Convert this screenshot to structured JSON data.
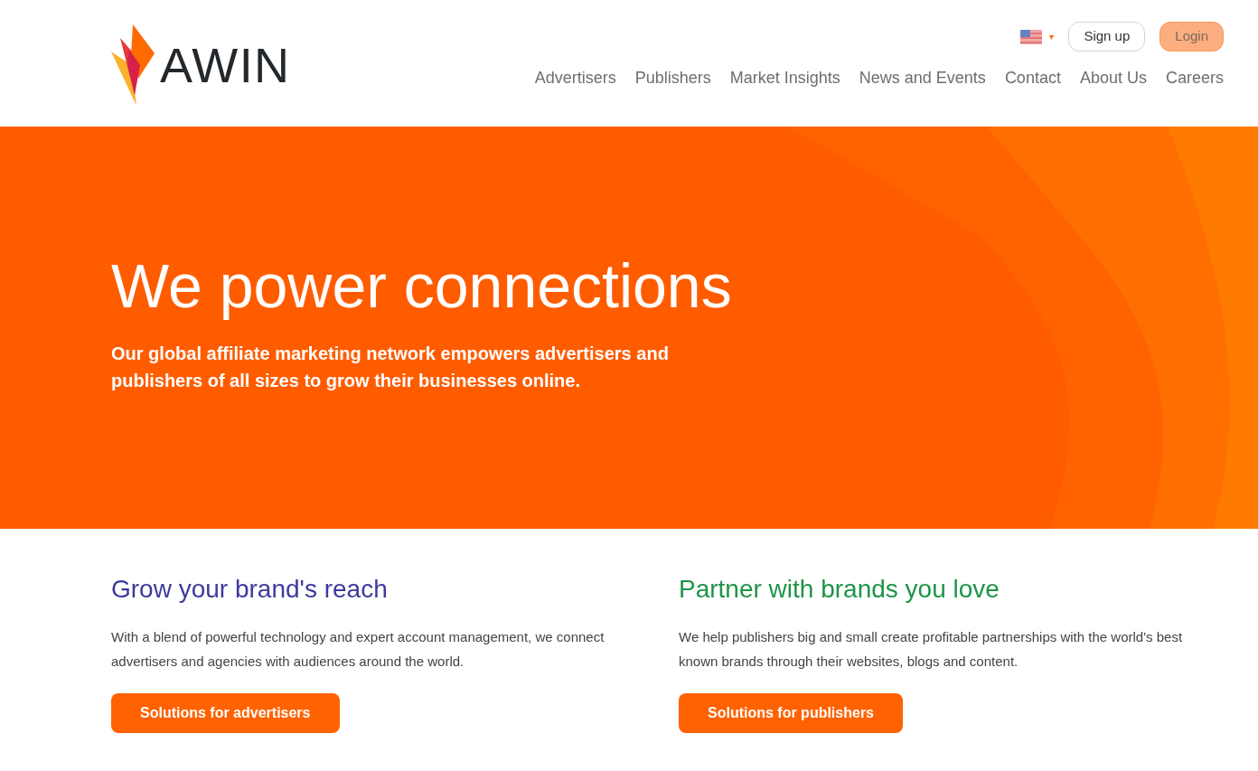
{
  "header": {
    "logo": "AWIN",
    "language_caret": "▾",
    "sign_up": "Sign up",
    "login": "Login",
    "nav": [
      {
        "label": "Advertisers"
      },
      {
        "label": "Publishers"
      },
      {
        "label": "Market Insights"
      },
      {
        "label": "News and Events"
      },
      {
        "label": "Contact"
      },
      {
        "label": "About Us"
      },
      {
        "label": "Careers"
      }
    ]
  },
  "hero": {
    "title": "We power connections",
    "subtitle": "Our global affiliate marketing network empowers advertisers and publishers of all sizes to grow their businesses online."
  },
  "columns": [
    {
      "heading": "Grow your brand's reach",
      "color": "#3d3a9e",
      "text": "With a blend of powerful technology and expert account management, we connect advertisers and agencies with audiences around the world.",
      "button": "Solutions for advertisers"
    },
    {
      "heading": "Partner with brands you love",
      "color": "#1e9448",
      "text": "We help publishers big and small create profitable partnerships with the world's best known brands through their websites, blogs and content.",
      "button": "Solutions for publishers"
    }
  ]
}
